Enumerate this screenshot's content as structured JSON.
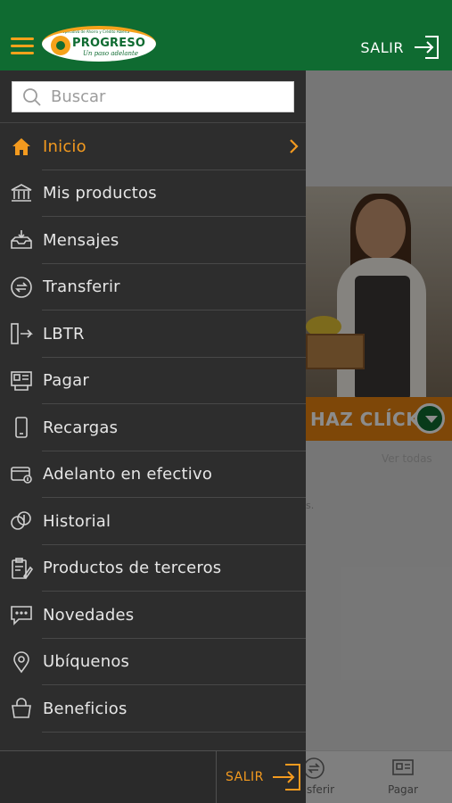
{
  "header": {
    "logo_brand": "PROGRESO",
    "logo_tagline": "Un paso adelante",
    "logo_small": "Cooperativa de Ahorro y Crédito Abierta",
    "logout_label": "SALIR"
  },
  "search": {
    "placeholder": "Buscar"
  },
  "menu": {
    "items": [
      {
        "label": "Inicio",
        "icon": "home-icon",
        "active": true
      },
      {
        "label": "Mis productos",
        "icon": "bank-icon"
      },
      {
        "label": "Mensajes",
        "icon": "inbox-icon"
      },
      {
        "label": "Transferir",
        "icon": "transfer-icon"
      },
      {
        "label": "LBTR",
        "icon": "lbtr-icon"
      },
      {
        "label": "Pagar",
        "icon": "pay-icon"
      },
      {
        "label": "Recargas",
        "icon": "phone-icon"
      },
      {
        "label": "Adelanto en efectivo",
        "icon": "card-icon"
      },
      {
        "label": "Historial",
        "icon": "coins-icon"
      },
      {
        "label": "Productos de terceros",
        "icon": "clipboard-icon"
      },
      {
        "label": "Novedades",
        "icon": "chat-icon"
      },
      {
        "label": "Ubíquenos",
        "icon": "location-icon"
      },
      {
        "label": "Beneficios",
        "icon": "bag-icon"
      }
    ]
  },
  "drawer_footer": {
    "logout_label": "SALIR"
  },
  "background": {
    "banner_cta": "HAZ CLÍCK",
    "see_all": "Ver todas",
    "bottom_nav": {
      "transfer_label": "ansferir",
      "pay_label": "Pagar"
    }
  },
  "colors": {
    "brand_green": "#0f6b31",
    "accent_orange": "#f39a1f"
  }
}
